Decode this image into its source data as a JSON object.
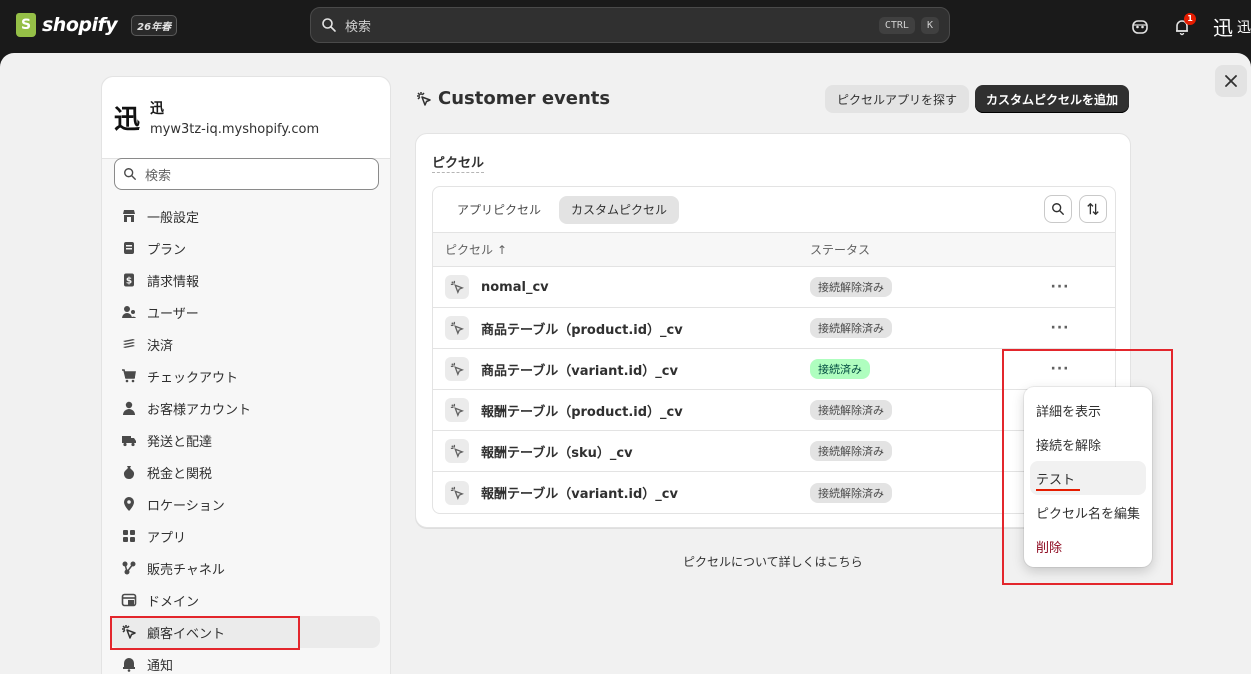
{
  "topbar": {
    "brand": "shopify",
    "edition": "26年春",
    "search_placeholder": "検索",
    "shortcut_key1": "CTRL",
    "shortcut_key2": "K",
    "notification_count": "1",
    "store_glyph": "迅",
    "store_short": "迅"
  },
  "store": {
    "glyph": "迅",
    "name": "迅",
    "domain": "myw3tz-iq.myshopify.com"
  },
  "sidebar": {
    "search_placeholder": "検索",
    "items": [
      {
        "label": "一般設定",
        "icon": "store-icon"
      },
      {
        "label": "プラン",
        "icon": "plan-icon"
      },
      {
        "label": "請求情報",
        "icon": "billing-icon"
      },
      {
        "label": "ユーザー",
        "icon": "users-icon"
      },
      {
        "label": "決済",
        "icon": "payments-icon"
      },
      {
        "label": "チェックアウト",
        "icon": "cart-icon"
      },
      {
        "label": "お客様アカウント",
        "icon": "person-icon"
      },
      {
        "label": "発送と配達",
        "icon": "truck-icon"
      },
      {
        "label": "税金と関税",
        "icon": "tax-icon"
      },
      {
        "label": "ロケーション",
        "icon": "location-icon"
      },
      {
        "label": "アプリ",
        "icon": "apps-icon"
      },
      {
        "label": "販売チャネル",
        "icon": "channels-icon"
      },
      {
        "label": "ドメイン",
        "icon": "domain-icon"
      },
      {
        "label": "顧客イベント",
        "icon": "pixel-icon",
        "active": true
      },
      {
        "label": "通知",
        "icon": "bell-icon"
      }
    ]
  },
  "page": {
    "title": "Customer events",
    "explore_button": "ピクセルアプリを探す",
    "add_button": "カスタムピクセルを追加",
    "card_title": "ピクセル",
    "tabs": [
      "アプリピクセル",
      "カスタムピクセル"
    ],
    "active_tab": "カスタムピクセル",
    "col_name": "ピクセル",
    "col_sort": "↑",
    "col_status": "ステータス",
    "rows": [
      {
        "name": "nomal_cv",
        "status": "接続解除済み",
        "connected": false
      },
      {
        "name": "商品テーブル（product.id）_cv",
        "status": "接続解除済み",
        "connected": false
      },
      {
        "name": "商品テーブル（variant.id）_cv",
        "status": "接続済み",
        "connected": true
      },
      {
        "name": "報酬テーブル（product.id）_cv",
        "status": "接続解除済み",
        "connected": false
      },
      {
        "name": "報酬テーブル（sku）_cv",
        "status": "接続解除済み",
        "connected": false
      },
      {
        "name": "報酬テーブル（variant.id）_cv",
        "status": "接続解除済み",
        "connected": false
      }
    ],
    "learn_more": "ピクセルについて詳しくはこちら"
  },
  "menu": {
    "items": [
      "詳細を表示",
      "接続を解除",
      "テスト",
      "ピクセル名を編集",
      "削除"
    ],
    "hovered": "テスト",
    "danger": "削除"
  },
  "colors": {
    "annotation": "#e3262c",
    "connected_bg": "#affebf",
    "danger": "#8e0b21"
  }
}
